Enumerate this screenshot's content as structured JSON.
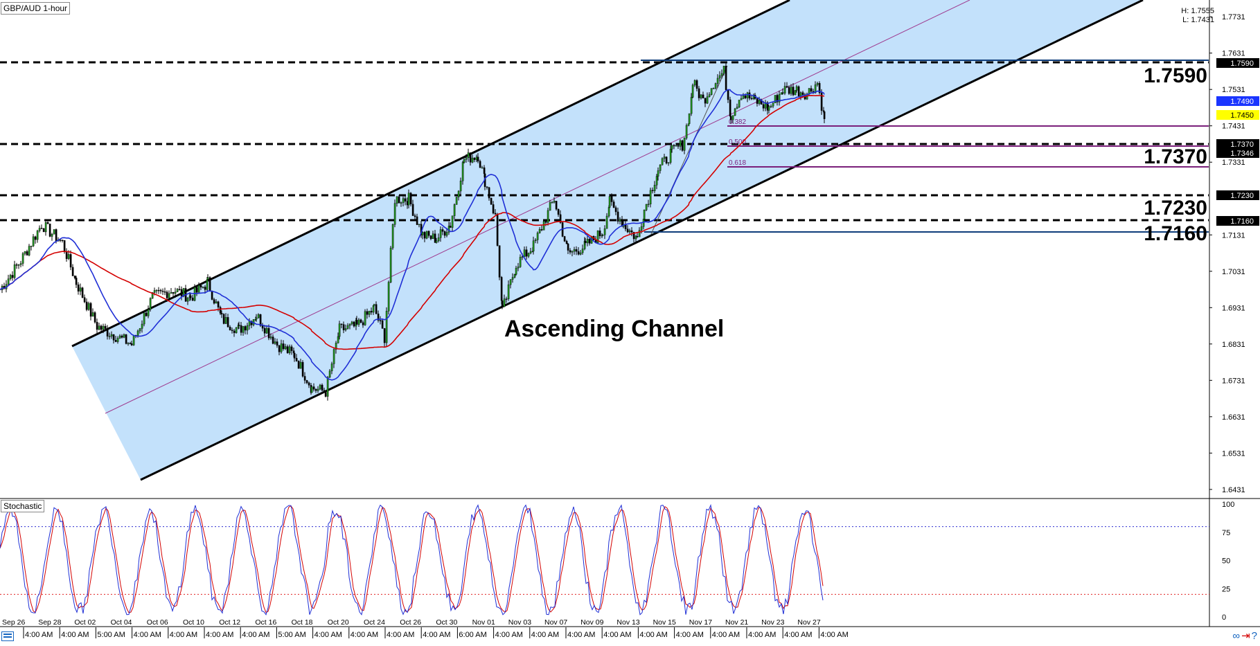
{
  "header": {
    "symbol": "GBP/AUD 1-hour",
    "high_label": "H: 1.7555",
    "low_label": "L: 1.7431"
  },
  "annotations": {
    "channel_label": "Ascending Channel",
    "levels": [
      {
        "label": "1.7590"
      },
      {
        "label": "1.7370"
      },
      {
        "label": "1.7230"
      },
      {
        "label": "1.7160"
      }
    ],
    "fib_labels": [
      "0.382",
      "0.500",
      "0.618"
    ]
  },
  "indicator": {
    "name": "Stochastic"
  },
  "chart_data": [
    {
      "type": "line",
      "title": "GBP/AUD 1-hour",
      "y_axis_ticks": [
        1.7731,
        1.7631,
        1.7531,
        1.7431,
        1.7331,
        1.7131,
        1.7031,
        1.6931,
        1.6831,
        1.6731,
        1.6631,
        1.6531,
        1.6431
      ],
      "ylim": [
        1.6406,
        1.7777
      ],
      "price_flags": [
        {
          "value": "1.7590",
          "bg": "#000000",
          "fg": "#ffffff"
        },
        {
          "value": "1.7490",
          "bg": "#1a35ff",
          "fg": "#ffffff"
        },
        {
          "value": "1.7450",
          "bg": "#ffff00",
          "fg": "#000000"
        },
        {
          "value": "1.7370",
          "bg": "#000000",
          "fg": "#ffffff"
        },
        {
          "value": "1.7346",
          "bg": "#000000",
          "fg": "#ffffff"
        },
        {
          "value": "1.7230",
          "bg": "#000000",
          "fg": "#ffffff"
        },
        {
          "value": "1.7160",
          "bg": "#000000",
          "fg": "#ffffff"
        }
      ],
      "x_date_labels": [
        "Sep 26",
        "Sep 28",
        "Oct 02",
        "Oct 04",
        "Oct 06",
        "Oct 10",
        "Oct 12",
        "Oct 16",
        "Oct 18",
        "Oct 20",
        "Oct 24",
        "Oct 26",
        "Oct 30",
        "Nov 01",
        "Nov 03",
        "Nov 07",
        "Nov 09",
        "Nov 13",
        "Nov 15",
        "Nov 17",
        "Nov 21",
        "Nov 23",
        "Nov 27"
      ],
      "x_time_labels": [
        "4:00 AM",
        "4:00 AM",
        "5:00 AM",
        "4:00 AM",
        "4:00 AM",
        "4:00 AM",
        "4:00 AM",
        "5:00 AM",
        "4:00 AM",
        "4:00 AM",
        "4:00 AM",
        "4:00 AM",
        "6:00 AM",
        "4:00 AM",
        "4:00 AM",
        "4:00 AM",
        "4:00 AM",
        "4:00 AM",
        "4:00 AM",
        "4:00 AM",
        "4:00 AM",
        "4:00 AM",
        "4:00 AM"
      ],
      "price_anchors": [
        [
          0,
          1.698
        ],
        [
          30,
          1.706
        ],
        [
          60,
          1.716
        ],
        [
          90,
          1.711
        ],
        [
          110,
          1.7
        ],
        [
          140,
          1.688
        ],
        [
          170,
          1.685
        ],
        [
          190,
          1.683
        ],
        [
          220,
          1.696
        ],
        [
          250,
          1.698
        ],
        [
          275,
          1.696
        ],
        [
          300,
          1.7
        ],
        [
          320,
          1.69
        ],
        [
          345,
          1.687
        ],
        [
          370,
          1.691
        ],
        [
          400,
          1.683
        ],
        [
          425,
          1.68
        ],
        [
          450,
          1.671
        ],
        [
          470,
          1.67
        ],
        [
          490,
          1.687
        ],
        [
          515,
          1.688
        ],
        [
          540,
          1.693
        ],
        [
          555,
          1.685
        ],
        [
          570,
          1.723
        ],
        [
          590,
          1.723
        ],
        [
          610,
          1.713
        ],
        [
          630,
          1.712
        ],
        [
          650,
          1.716
        ],
        [
          670,
          1.734
        ],
        [
          690,
          1.735
        ],
        [
          700,
          1.728
        ],
        [
          715,
          1.718
        ],
        [
          725,
          1.692
        ],
        [
          745,
          1.705
        ],
        [
          770,
          1.71
        ],
        [
          800,
          1.723
        ],
        [
          820,
          1.708
        ],
        [
          845,
          1.71
        ],
        [
          870,
          1.714
        ],
        [
          880,
          1.722
        ],
        [
          900,
          1.716
        ],
        [
          920,
          1.712
        ],
        [
          930,
          1.72
        ],
        [
          950,
          1.731
        ],
        [
          970,
          1.736
        ],
        [
          985,
          1.738
        ],
        [
          995,
          1.746
        ],
        [
          1000,
          1.755
        ],
        [
          1015,
          1.75
        ],
        [
          1030,
          1.755
        ],
        [
          1045,
          1.758
        ],
        [
          1055,
          1.746
        ],
        [
          1070,
          1.752
        ],
        [
          1090,
          1.75
        ],
        [
          1110,
          1.748
        ],
        [
          1130,
          1.753
        ],
        [
          1150,
          1.753
        ],
        [
          1165,
          1.752
        ],
        [
          1180,
          1.755
        ],
        [
          1190,
          1.745
        ]
      ],
      "series": [
        {
          "name": "",
          "color": "#d40000"
        },
        {
          "name": "",
          "color": "#1f2fd6"
        }
      ]
    },
    {
      "type": "line",
      "title": "Stochastic",
      "ylim": [
        0,
        100
      ],
      "y_axis_ticks": [
        100,
        75,
        50,
        25,
        0
      ],
      "overbought": 80,
      "oversold": 20,
      "series": [
        {
          "name": "",
          "color": "#1f2fd6"
        },
        {
          "name": "",
          "color": "#d40000"
        }
      ]
    }
  ]
}
